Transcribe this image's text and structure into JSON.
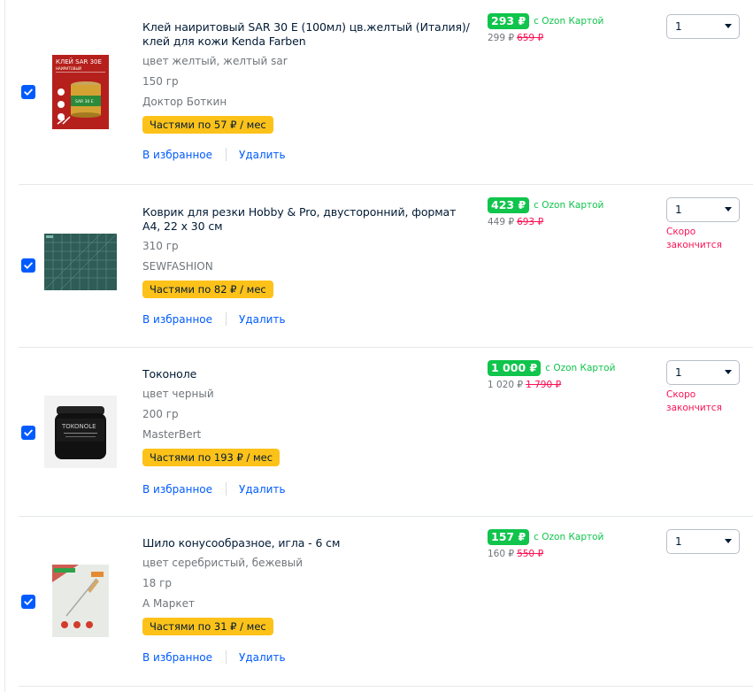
{
  "items": [
    {
      "title": "Клей наиритовый SAR 30 E (100мл) цв.желтый (Италия)/клей для кожи Kenda Farben",
      "attrs": [
        "цвет желтый, желтый sar",
        "150 гр",
        "Доктор Боткин"
      ],
      "installment": "Частями по 57 ₽ / мес",
      "favorite": "В избранное",
      "delete": "Удалить",
      "price": "293 ₽",
      "ozon_card": "с Ozon Картой",
      "price_regular": "299 ₽",
      "price_old": "659 ₽",
      "quantity": "1",
      "low_stock": "",
      "thumb_text": [
        "КЛЕЙ SAR 30E",
        "НАИРИТОВЫЙ",
        "SAR 30 E"
      ]
    },
    {
      "title": "Коврик для резки Hobby & Pro, двусторонний, формат А4, 22 х 30 см",
      "attrs": [
        "310 гр",
        "SEWFASHION"
      ],
      "installment": "Частями по 82 ₽ / мес",
      "favorite": "В избранное",
      "delete": "Удалить",
      "price": "423 ₽",
      "ozon_card": "с Ozon Картой",
      "price_regular": "449 ₽",
      "price_old": "693 ₽",
      "quantity": "1",
      "low_stock": "Скоро закончится"
    },
    {
      "title": "Токоноле",
      "attrs": [
        "цвет черный",
        "200 гр",
        "MasterBert"
      ],
      "installment": "Частями по 193 ₽ / мес",
      "favorite": "В избранное",
      "delete": "Удалить",
      "price": "1 000 ₽",
      "ozon_card": "с Ozon Картой",
      "price_regular": "1 020 ₽",
      "price_old": "1 790 ₽",
      "quantity": "1",
      "low_stock": "Скоро закончится",
      "thumb_text": [
        "TOKONOLE"
      ]
    },
    {
      "title": "Шило конусообразное, игла - 6 см",
      "attrs": [
        "цвет серебристый, бежевый",
        "18 гр",
        "А Маркет"
      ],
      "installment": "Частями по 31 ₽ / мес",
      "favorite": "В избранное",
      "delete": "Удалить",
      "price": "157 ₽",
      "ozon_card": "с Ozon Картой",
      "price_regular": "160 ₽",
      "price_old": "550 ₽",
      "quantity": "1",
      "low_stock": ""
    }
  ],
  "colors": {
    "accent_blue": "#005bff",
    "price_green": "#10c44c",
    "installment_yellow": "#fdc21a",
    "alert_red": "#f91155"
  },
  "icons": {
    "checkbox": "check-icon",
    "select": "chevron-down-icon"
  }
}
